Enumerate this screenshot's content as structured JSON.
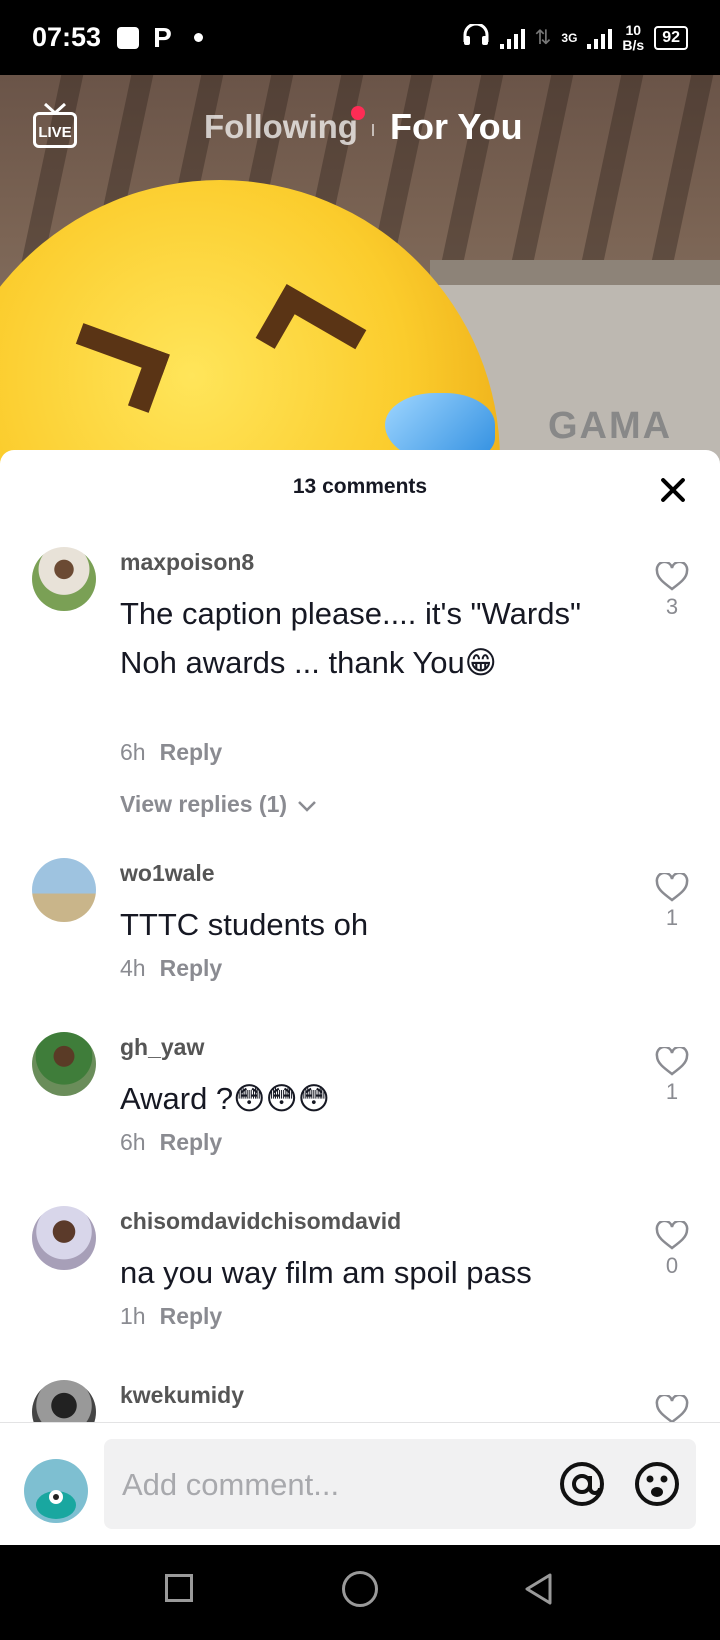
{
  "status_bar": {
    "time": "07:53",
    "notification_letter": "P",
    "network_type": "3G",
    "speed_value": "10",
    "speed_unit": "B/s",
    "battery": "92"
  },
  "video": {
    "live_label": "LIVE",
    "tab_following": "Following",
    "tab_for_you": "For You",
    "sign_text": "GAMA"
  },
  "comments_sheet": {
    "title": "13 comments",
    "comments": [
      {
        "username": "maxpoison8",
        "text": "The caption please.... it's \"Wards\" Noh awards ... thank You😁",
        "time": "6h",
        "reply_label": "Reply",
        "likes": "3",
        "view_replies": "View replies (1)"
      },
      {
        "username": "wo1wale",
        "text": "TTTC students oh",
        "time": "4h",
        "reply_label": "Reply",
        "likes": "1"
      },
      {
        "username": "gh_yaw",
        "text": "Award ?😳😳😳",
        "time": "6h",
        "reply_label": "Reply",
        "likes": "1"
      },
      {
        "username": "chisomdavidchisomdavid",
        "text": "na you way film am spoil pass",
        "time": "1h",
        "reply_label": "Reply",
        "likes": "0"
      },
      {
        "username": "kwekumidy"
      }
    ]
  },
  "composer": {
    "placeholder": "Add comment...",
    "value": ""
  },
  "colors": {
    "accent_dot": "#fe2c55",
    "text_primary": "#161823",
    "text_secondary": "#8a8b91"
  },
  "icons": {
    "close": "close-icon",
    "like": "heart-outline-icon",
    "mention": "at-icon",
    "emoji": "emoji-icon"
  }
}
